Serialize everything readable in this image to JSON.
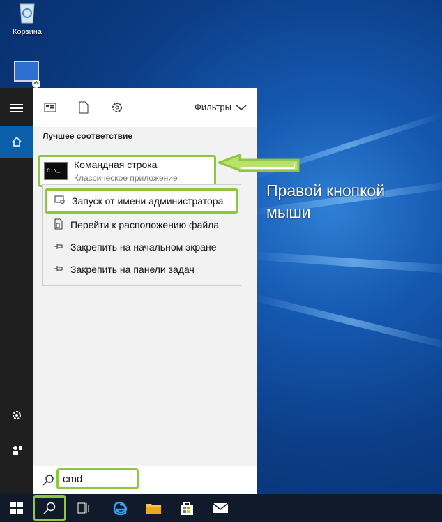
{
  "desktop": {
    "recycle_bin_label": "Корзина"
  },
  "start_menu": {
    "filters_label": "Фильтры",
    "section_title": "Лучшее соответствие",
    "best_match": {
      "title": "Командная строка",
      "subtitle": "Классическое приложение"
    },
    "context_menu": [
      {
        "label": "Запуск от имени администратора",
        "icon": "shield-window-icon"
      },
      {
        "label": "Перейти к расположению файла",
        "icon": "file-location-icon"
      },
      {
        "label": "Закрепить на начальном экране",
        "icon": "pin-icon"
      },
      {
        "label": "Закрепить на панели задач",
        "icon": "pin-icon"
      }
    ],
    "search_value": "cmd"
  },
  "annotation": {
    "line1": "Правой кнопкой",
    "line2": "мыши"
  },
  "colors": {
    "highlight_green": "#8dc63f",
    "rail_active": "#0b5ea8",
    "taskbar": "#101a2a"
  }
}
